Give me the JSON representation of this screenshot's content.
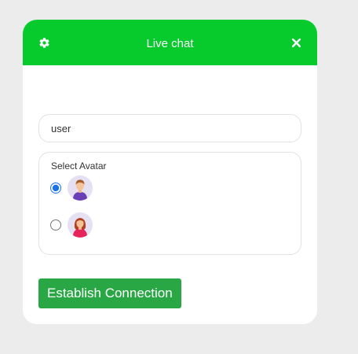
{
  "header": {
    "title": "Live chat",
    "background_color": "#07cb2c",
    "settings_icon": "gear-icon",
    "close_icon": "close-icon"
  },
  "form": {
    "name_value": "user",
    "avatar_label": "Select Avatar",
    "avatars": [
      {
        "name": "male-avatar",
        "selected": true
      },
      {
        "name": "female-avatar",
        "selected": false
      }
    ],
    "connect_label": "Establish Connection",
    "connect_color": "#29a744"
  }
}
